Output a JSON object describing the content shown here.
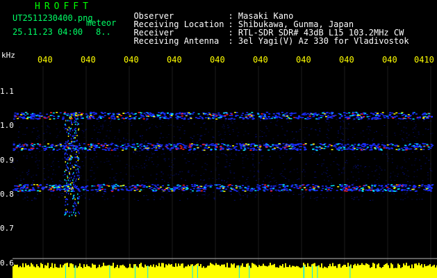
{
  "header": {
    "app_title": "HROFFT",
    "filename": "UT2511230400.png",
    "datetime": "25.11.23 04:00",
    "meteor_label": "meteor",
    "meteor_count": "8.."
  },
  "station_info": [
    {
      "key": "Observer",
      "value": ": Masaki Kano"
    },
    {
      "key": "Receiving Location",
      "value": ": Shibukawa, Gunma, Japan"
    },
    {
      "key": "Receiver",
      "value": ": RTL-SDR SDR# 43dB L15 103.2MHz CW"
    },
    {
      "key": "Receiving Antenna",
      "value": ": 3el Yagi(V) Az 330 for Vladivostok"
    }
  ],
  "axis": {
    "y_unit": "kHz",
    "x_ticks": [
      "040",
      "040",
      "040",
      "040",
      "040",
      "040",
      "040",
      "040",
      "040",
      "0410"
    ],
    "y_ticks": [
      "1.1",
      "1.0",
      "0.9",
      "0.8",
      "0.7",
      "0.6"
    ]
  },
  "colors": {
    "background": "#000000",
    "title_green": "#00ff00",
    "tick_yellow": "#ffff00",
    "info_white": "#ffffff",
    "signal_blue": "#1a2cff",
    "signal_red": "#ff2020",
    "signal_yellow": "#ffff00",
    "signal_cyan": "#00e5ff"
  },
  "spectrogram": {
    "freq_range_khz": [
      0.6,
      1.12
    ],
    "bands_khz": [
      0.985,
      0.905,
      0.8
    ],
    "meteor_count": 8
  }
}
